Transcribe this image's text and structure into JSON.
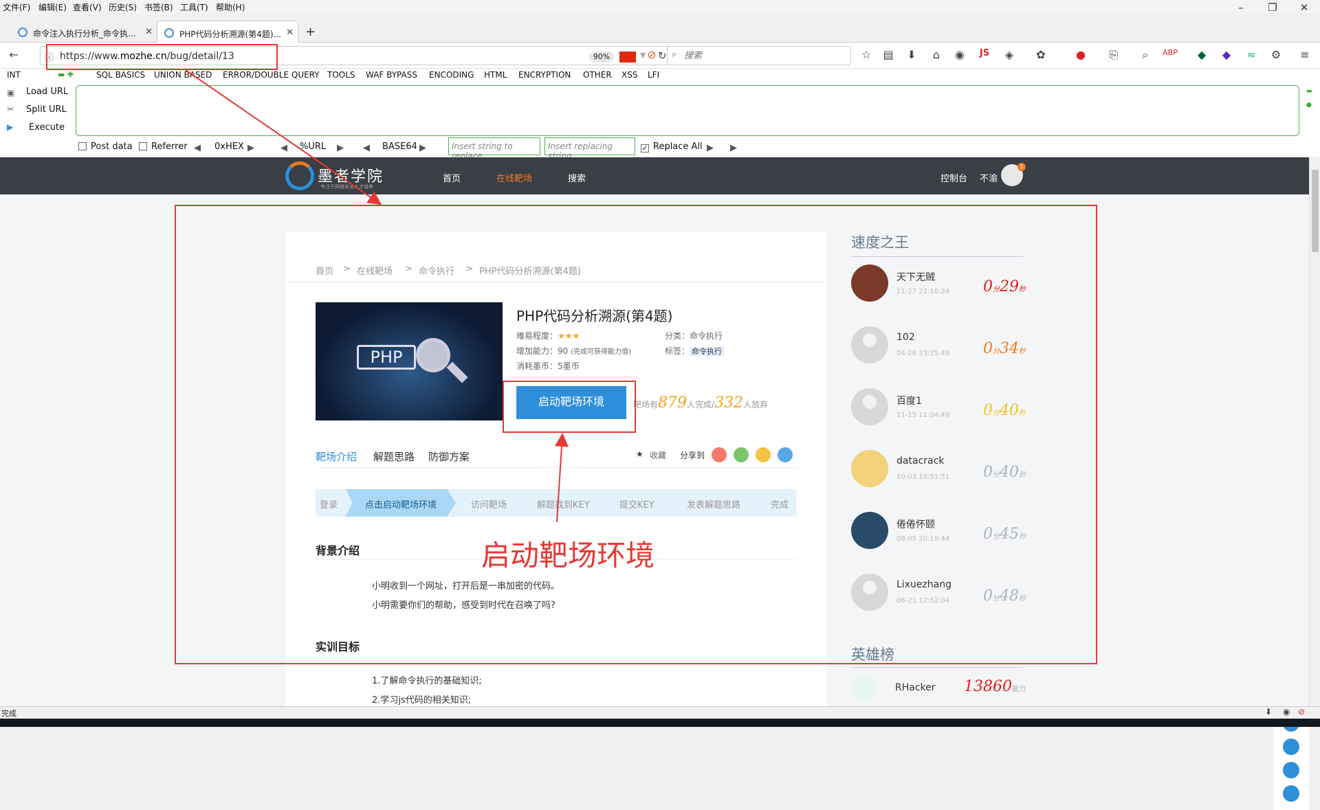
{
  "menubar": {
    "items": [
      "文件(F)",
      "编辑(E)",
      "查看(V)",
      "历史(S)",
      "书签(B)",
      "工具(T)",
      "帮助(H)"
    ]
  },
  "tabs": [
    {
      "label": "命令注入执行分析_命令执...",
      "active": false
    },
    {
      "label": "PHP代码分析溯源(第4题)...",
      "active": true
    }
  ],
  "nav": {
    "url_prefix": "https://www.",
    "url_domain": "mozhe.cn",
    "url_path": "/bug/detail/13",
    "zoom": "90%",
    "search_placeholder": "搜索"
  },
  "hackbar": {
    "menus": [
      "INT",
      "SQL BASICS",
      "UNION BASED",
      "ERROR/DOUBLE QUERY",
      "TOOLS",
      "WAF BYPASS",
      "ENCODING",
      "HTML",
      "ENCRYPTION",
      "OTHER",
      "XSS",
      "LFI"
    ],
    "load_url": "Load URL",
    "split_url": "Split URL",
    "execute": "Execute",
    "post_data": "Post data",
    "referrer": "Referrer",
    "hex": "0xHEX",
    "url_enc": "%URL",
    "base64": "BASE64",
    "insert_placeholder": "Insert string to replace",
    "replacing_placeholder": "Insert replacing string",
    "replace_all": "Replace All"
  },
  "site": {
    "logo_text": "墨者学院",
    "logo_sub": "专注于网络安全人才培养",
    "nav": [
      "首页",
      "在线靶场",
      "搜索"
    ],
    "console": "控制台",
    "user": "不渝",
    "badge": "1"
  },
  "card": {
    "breadcrumb": [
      "首页",
      ">",
      "在线靶场",
      ">",
      "命令执行",
      ">",
      "PHP代码分析溯源(第4题)"
    ],
    "thumb_text": "PHP",
    "title": "PHP代码分析溯源(第4题)",
    "difficulty_label": "难易程度：",
    "difficulty_stars": "★★★",
    "ability_label": "增加能力：90",
    "ability_note": "(完成可获得能力值)",
    "coins": "消耗墨币：5墨币",
    "category": "分类：命令执行",
    "tag_label": "标签：",
    "tag": "命令执行",
    "start_button": "启动靶场环境",
    "counter_pre": "靶场有",
    "completed": "879",
    "counter_mid": "人完成/",
    "abandoned": "332",
    "counter_post": "人放弃",
    "tabs": [
      "靶场介绍",
      "解题思路",
      "防御方案"
    ],
    "favorite": "收藏",
    "share": "分享到",
    "steps": [
      "登录",
      "点击启动靶场环境",
      "访问靶场",
      "解题找到KEY",
      "提交KEY",
      "发表解题思路",
      "完成"
    ],
    "bg_title": "背景介绍",
    "bg_lines": [
      "小明收到一个网址，打开后是一串加密的代码。",
      "小明需要你们的帮助，感受到时代在召唤了吗?"
    ],
    "goal_title": "实训目标",
    "goal_lines": [
      "1.了解命令执行的基础知识;",
      "2.学习js代码的相关知识;"
    ]
  },
  "sidebar": {
    "speed_title": "速度之王",
    "ranks": [
      {
        "name": "天下无贼",
        "time": "11-27 22:10:24",
        "min": "0",
        "sec": "29",
        "color": "#e0201a"
      },
      {
        "name": "102",
        "time": "04-26 23:25:48",
        "min": "0",
        "sec": "34",
        "color": "#f07d1c"
      },
      {
        "name": "百度1",
        "time": "11-15 11:04:49",
        "min": "0",
        "sec": "40",
        "color": "#f4c21d"
      },
      {
        "name": "datacrack",
        "time": "10-03 19:51:51",
        "min": "0",
        "sec": "40",
        "color": "#aab4be"
      },
      {
        "name": "倦倦怀颐",
        "time": "08-05 20:19:44",
        "min": "0",
        "sec": "45",
        "color": "#aab4be"
      },
      {
        "name": "Lixuezhang",
        "time": "06-21 12:52:04",
        "min": "0",
        "sec": "48",
        "color": "#aab4be"
      }
    ],
    "unit_min": "分",
    "unit_sec": "秒",
    "hero_title": "英雄榜",
    "hero": {
      "name": "RHacker",
      "score": "13860",
      "unit": "能力"
    }
  },
  "annotation": {
    "text": "启动靶场环境"
  },
  "status": {
    "text": "完成"
  }
}
